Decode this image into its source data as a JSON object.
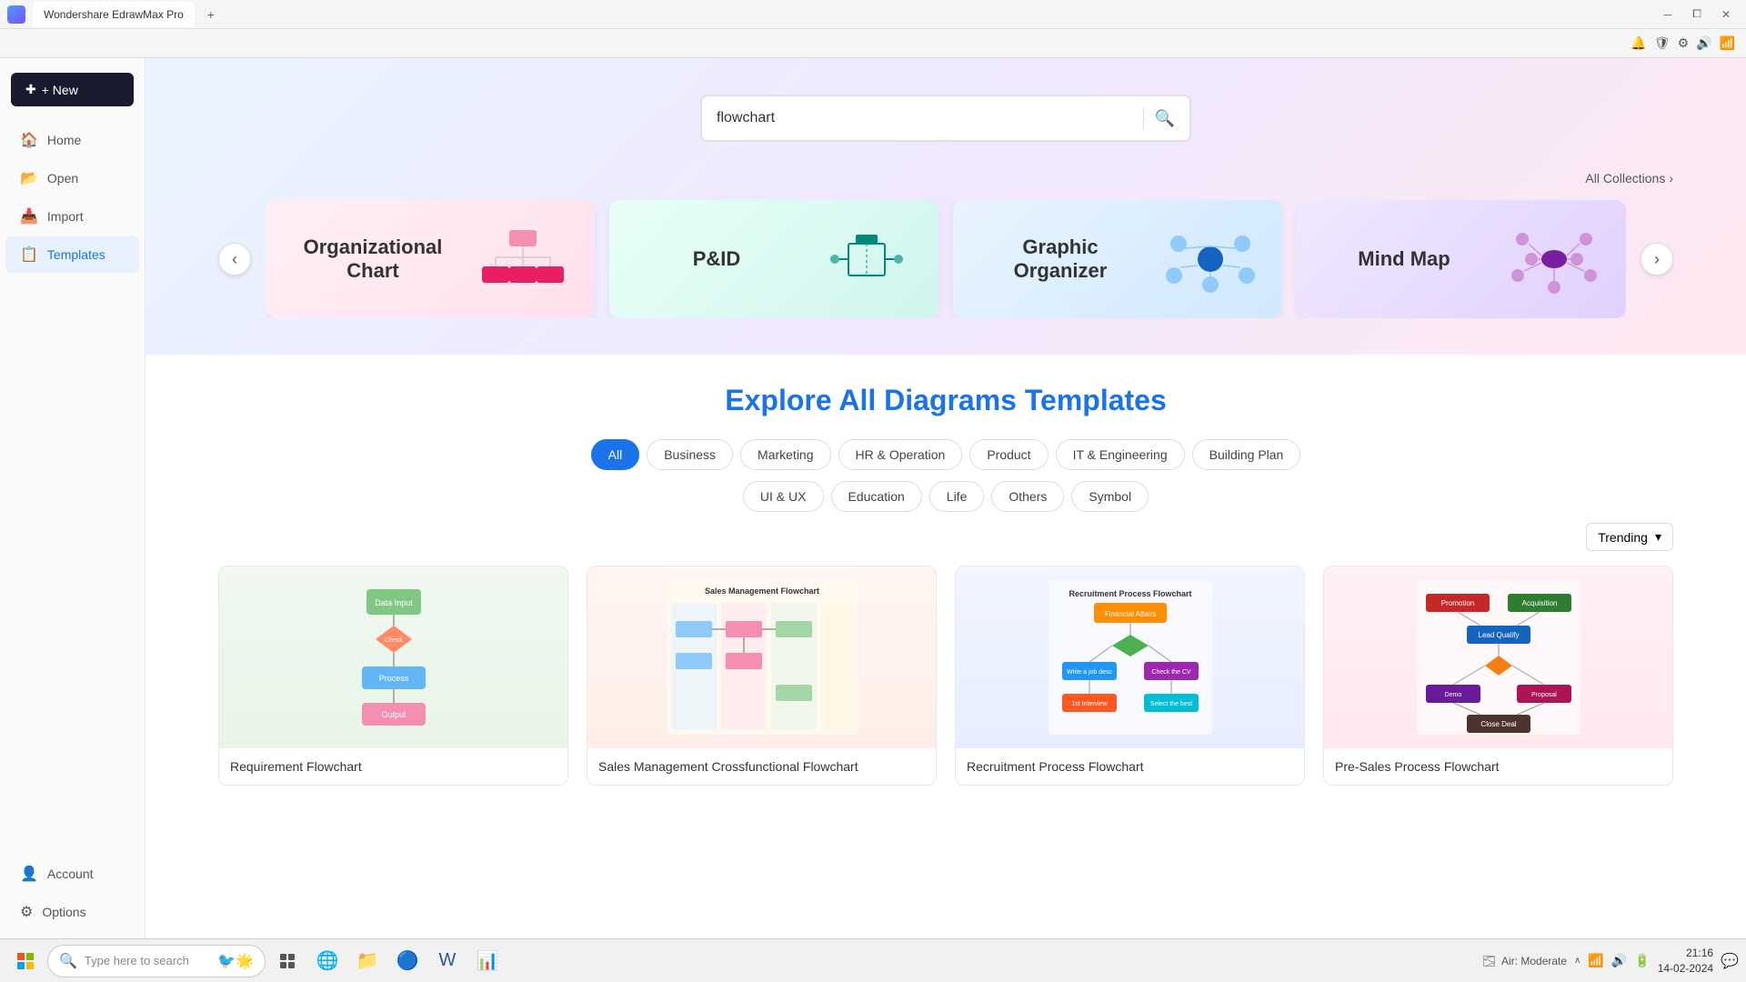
{
  "titlebar": {
    "app_name": "Wondershare EdrawMax",
    "badge": "Pro",
    "tab_label": "Wondershare EdrawMax Pro",
    "add_tab": "+",
    "controls": [
      "—",
      "⧠",
      "✕"
    ]
  },
  "sysbar": {
    "icons": [
      "🔔",
      "🛡",
      "⚙",
      "🔊",
      "📶"
    ]
  },
  "sidebar": {
    "new_button": "+ New",
    "items": [
      {
        "id": "home",
        "icon": "🏠",
        "label": "Home"
      },
      {
        "id": "open",
        "icon": "📂",
        "label": "Open"
      },
      {
        "id": "import",
        "icon": "📥",
        "label": "Import"
      },
      {
        "id": "templates",
        "icon": "📋",
        "label": "Templates",
        "active": true
      }
    ],
    "bottom_items": [
      {
        "id": "account",
        "icon": "👤",
        "label": "Account"
      },
      {
        "id": "options",
        "icon": "⚙",
        "label": "Options"
      }
    ]
  },
  "search": {
    "placeholder": "flowchart",
    "value": "flowchart"
  },
  "carousel": {
    "prev_btn": "‹",
    "next_btn": "›",
    "all_collections": "All Collections",
    "cards": [
      {
        "id": "org-chart",
        "title": "Organizational Chart",
        "theme": "pink"
      },
      {
        "id": "pid",
        "title": "P&ID",
        "theme": "teal"
      },
      {
        "id": "graphic-organizer",
        "title": "Graphic Organizer",
        "theme": "blue"
      },
      {
        "id": "mind-map",
        "title": "Mind Map",
        "theme": "purple"
      }
    ]
  },
  "explore": {
    "title_static": "Explore",
    "title_highlight": "All Diagrams Templates",
    "filters": [
      {
        "id": "all",
        "label": "All",
        "active": true
      },
      {
        "id": "business",
        "label": "Business"
      },
      {
        "id": "marketing",
        "label": "Marketing"
      },
      {
        "id": "hr-operation",
        "label": "HR & Operation"
      },
      {
        "id": "product",
        "label": "Product"
      },
      {
        "id": "it-engineering",
        "label": "IT & Engineering"
      },
      {
        "id": "building-plan",
        "label": "Building Plan"
      },
      {
        "id": "ui-ux",
        "label": "UI & UX"
      },
      {
        "id": "education",
        "label": "Education"
      },
      {
        "id": "life",
        "label": "Life"
      },
      {
        "id": "others",
        "label": "Others"
      },
      {
        "id": "symbol",
        "label": "Symbol"
      }
    ],
    "sort_label": "Trending",
    "templates": [
      {
        "id": "req-flowchart",
        "name": "Requirement Flowchart",
        "thumb_color": "#f0f8f0"
      },
      {
        "id": "sales-mgmt",
        "name": "Sales Management Crossfunctional Flowchart",
        "thumb_color": "#fff5f0"
      },
      {
        "id": "recruitment",
        "name": "Recruitment Process Flowchart",
        "thumb_color": "#f0f5ff"
      },
      {
        "id": "pre-sales",
        "name": "Pre-Sales Process Flowchart",
        "thumb_color": "#fff0f5"
      }
    ]
  },
  "taskbar": {
    "search_placeholder": "Type here to search",
    "tray_text": "Air: Moderate",
    "time": "21:16",
    "date": "14-02-2024"
  }
}
